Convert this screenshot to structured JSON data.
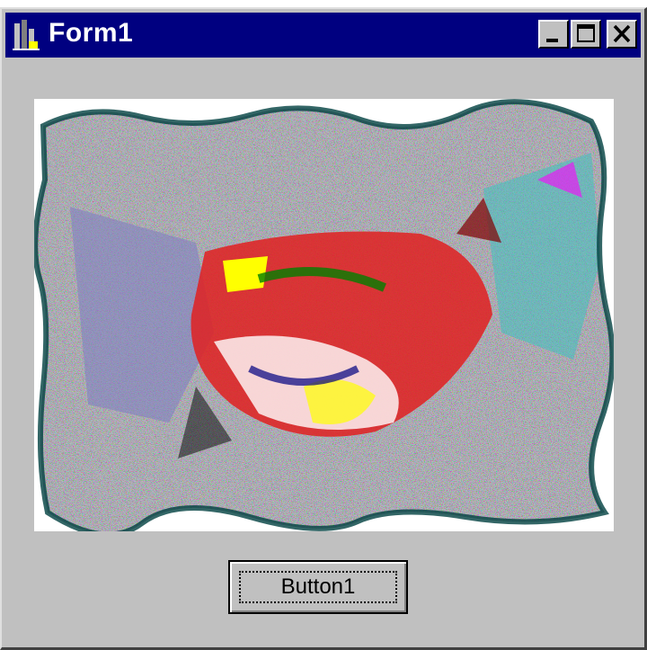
{
  "window": {
    "title": "Form1",
    "controls": {
      "minimize": "minimize",
      "maximize": "maximize",
      "close": "close"
    }
  },
  "picture": {
    "icon": "painted-image",
    "colors": {
      "background": "#c0c0c0",
      "title_bar": "#000080",
      "image_palette": [
        "#ff0000",
        "#ffff00",
        "#00ffff",
        "#ff00ff",
        "#008000",
        "#000080",
        "#808080",
        "#ffffff",
        "#800000"
      ]
    }
  },
  "button1": {
    "label": "Button1"
  }
}
